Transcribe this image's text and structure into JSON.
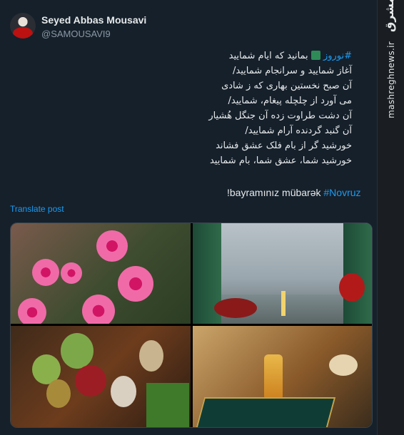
{
  "user": {
    "name": "Seyed Abbas Mousavi",
    "handle": "@SAMOUSAVI9"
  },
  "sidebar": {
    "brand": "مشرق",
    "site": "mashreghnews.ir"
  },
  "poem": {
    "line1_tag": "#نوروز",
    "line1_text": " بمانید که ایام شمایید",
    "line2": "آغاز شمایید و سرانجام شمایید/",
    "line3": "آن صبح نخستین بهاری که ز شادی",
    "line4": "می آورد از چلچله پیغام، شمایید/",
    "line5": "آن دشت طراوت زده آن جنگل هُشیار",
    "line6": "آن گنبد گردنده آرام شمایید/",
    "line7": "خورشید گر از بام فلک عشق فشاند",
    "line8": "خورشید شما، عشق شما، بام شمایید"
  },
  "bayram": {
    "text": "!bayramınız mübarək ",
    "tag": "#Novruz"
  },
  "translate_label": "Translate post",
  "images": [
    {
      "alt": "flowers"
    },
    {
      "alt": "haft-sin table with sea view"
    },
    {
      "alt": "painted eggs and fruit"
    },
    {
      "alt": "quran and glassware"
    }
  ]
}
